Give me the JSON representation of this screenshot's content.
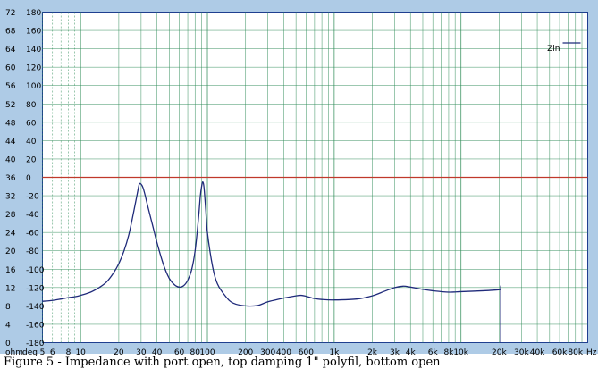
{
  "chart_data": {
    "type": "line",
    "title": "",
    "axis_units": {
      "left_outer": "ohm",
      "left_inner": "deg",
      "x_unit": "Hz"
    },
    "x_scale": "log",
    "xlim": [
      5,
      100000
    ],
    "ylim_ohm": [
      0,
      72
    ],
    "ylim_deg": [
      -180,
      180
    ],
    "ohm_ticks": [
      "72",
      "68",
      "64",
      "60",
      "56",
      "52",
      "48",
      "44",
      "40",
      "36",
      "32",
      "28",
      "24",
      "20",
      "16",
      "12",
      "8",
      "4",
      "0"
    ],
    "deg_ticks": [
      "180",
      "160",
      "140",
      "120",
      "100",
      "80",
      "60",
      "40",
      "20",
      "0",
      "-20",
      "-40",
      "-60",
      "-80",
      "-100",
      "-120",
      "-140",
      "-160",
      "-180"
    ],
    "x_tick_labels": [
      {
        "value": 5,
        "label": "5"
      },
      {
        "value": 6,
        "label": "6"
      },
      {
        "value": 8,
        "label": "8"
      },
      {
        "value": 10,
        "label": "10"
      },
      {
        "value": 20,
        "label": "20"
      },
      {
        "value": 30,
        "label": "30"
      },
      {
        "value": 40,
        "label": "40"
      },
      {
        "value": 60,
        "label": "60"
      },
      {
        "value": 80,
        "label": "80"
      },
      {
        "value": 100,
        "label": "100"
      },
      {
        "value": 200,
        "label": "200"
      },
      {
        "value": 300,
        "label": "300"
      },
      {
        "value": 400,
        "label": "400"
      },
      {
        "value": 600,
        "label": "600"
      },
      {
        "value": 1000,
        "label": "1k"
      },
      {
        "value": 2000,
        "label": "2k"
      },
      {
        "value": 3000,
        "label": "3k"
      },
      {
        "value": 4000,
        "label": "4k"
      },
      {
        "value": 6000,
        "label": "6k"
      },
      {
        "value": 8000,
        "label": "8k"
      },
      {
        "value": 10000,
        "label": "10k"
      },
      {
        "value": 20000,
        "label": "20k"
      },
      {
        "value": 30000,
        "label": "30k"
      },
      {
        "value": 40000,
        "label": "40k"
      },
      {
        "value": 60000,
        "label": "60k"
      },
      {
        "value": 80000,
        "label": "80k"
      },
      {
        "value": 100000,
        "label": "Hz"
      }
    ],
    "grid": true,
    "reference_line": {
      "value_ohm": 36,
      "color": "#c0392b"
    },
    "legend": {
      "position": "top-right"
    },
    "series": [
      {
        "name": "Zin",
        "color": "#1f2a7a",
        "points": [
          [
            5,
            9.0
          ],
          [
            6,
            9.2
          ],
          [
            7,
            9.5
          ],
          [
            8,
            9.8
          ],
          [
            9,
            10.0
          ],
          [
            10,
            10.3
          ],
          [
            12,
            11.0
          ],
          [
            14,
            12.0
          ],
          [
            16,
            13.2
          ],
          [
            18,
            15.0
          ],
          [
            20,
            17.2
          ],
          [
            22,
            20.0
          ],
          [
            24,
            23.5
          ],
          [
            26,
            28.0
          ],
          [
            28,
            32.5
          ],
          [
            29,
            34.5
          ],
          [
            30,
            34.5
          ],
          [
            31,
            33.8
          ],
          [
            32,
            32.5
          ],
          [
            34,
            29.5
          ],
          [
            37,
            25.5
          ],
          [
            40,
            21.8
          ],
          [
            45,
            17.0
          ],
          [
            50,
            14.0
          ],
          [
            55,
            12.6
          ],
          [
            60,
            12.1
          ],
          [
            65,
            12.4
          ],
          [
            70,
            13.6
          ],
          [
            75,
            15.8
          ],
          [
            80,
            20.0
          ],
          [
            85,
            27.0
          ],
          [
            88,
            32.0
          ],
          [
            90,
            34.0
          ],
          [
            92,
            35.0
          ],
          [
            94,
            33.8
          ],
          [
            97,
            29.0
          ],
          [
            100,
            24.0
          ],
          [
            110,
            16.5
          ],
          [
            120,
            12.8
          ],
          [
            140,
            10.0
          ],
          [
            160,
            8.6
          ],
          [
            200,
            8.0
          ],
          [
            250,
            8.1
          ],
          [
            300,
            8.9
          ],
          [
            400,
            9.7
          ],
          [
            500,
            10.2
          ],
          [
            550,
            10.3
          ],
          [
            600,
            10.1
          ],
          [
            700,
            9.6
          ],
          [
            800,
            9.4
          ],
          [
            1000,
            9.3
          ],
          [
            1500,
            9.5
          ],
          [
            2000,
            10.2
          ],
          [
            2500,
            11.2
          ],
          [
            3000,
            12.0
          ],
          [
            3500,
            12.3
          ],
          [
            4000,
            12.1
          ],
          [
            5000,
            11.6
          ],
          [
            6000,
            11.3
          ],
          [
            8000,
            11.0
          ],
          [
            10000,
            11.1
          ],
          [
            15000,
            11.3
          ],
          [
            20000,
            11.5
          ],
          [
            20600,
            11.5
          ],
          [
            20600,
            0
          ]
        ]
      }
    ],
    "caption": "Figure 5 - Impedance with port open, top damping 1\" polyfil, bottom open"
  }
}
